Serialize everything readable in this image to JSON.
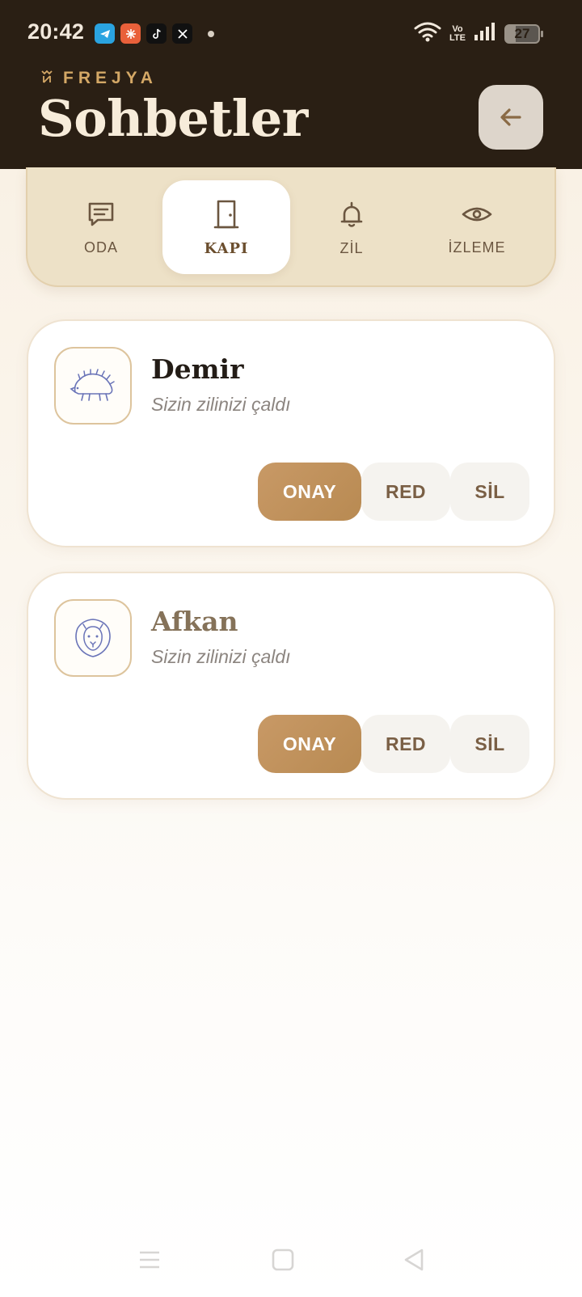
{
  "status_bar": {
    "time": "20:42",
    "volte_top": "Vo",
    "volte_bottom": "LTE",
    "battery": "27"
  },
  "header": {
    "brand": "FREJYA",
    "title": "Sohbetler"
  },
  "tabs": [
    {
      "label": "ODA",
      "icon": "chat-icon"
    },
    {
      "label": "KAPI",
      "icon": "door-icon",
      "active": true
    },
    {
      "label": "ZİL",
      "icon": "bell-icon"
    },
    {
      "label": "İZLEME",
      "icon": "eye-icon"
    }
  ],
  "requests": [
    {
      "name": "Demir",
      "subtitle": "Sizin zilinizi çaldı",
      "avatar": "hedgehog-icon",
      "approve": "ONAY",
      "reject": "RED",
      "delete": "SİL"
    },
    {
      "name": "Afkan",
      "subtitle": "Sizin zilinizi çaldı",
      "avatar": "lion-icon",
      "approve": "ONAY",
      "reject": "RED",
      "delete": "SİL"
    }
  ],
  "colors": {
    "header_bg": "#2a1f14",
    "accent": "#b88a52",
    "brand": "#d4a866",
    "tab_bar": "#ede1c7"
  }
}
